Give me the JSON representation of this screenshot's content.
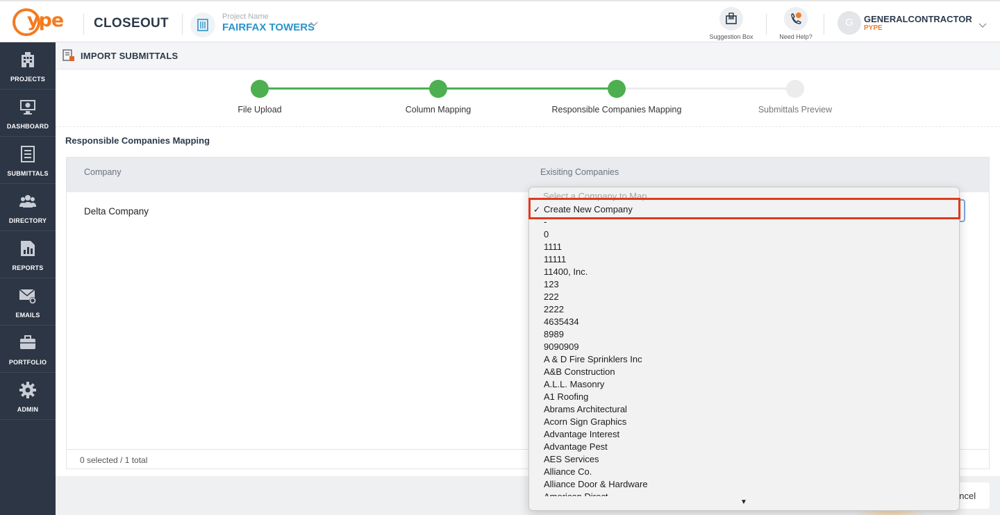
{
  "header": {
    "logo_text": "ype",
    "app_name": "CLOSEOUT",
    "project_label": "Project Name",
    "project_name": "FAIRFAX TOWERS",
    "suggestion_label": "Suggestion Box",
    "help_label": "Need Help?",
    "avatar_initial": "G",
    "user_name": "GENERALCONTRACTOR",
    "user_org": "PYPE"
  },
  "sidebar": {
    "items": [
      {
        "label": "PROJECTS",
        "icon": "building-icon"
      },
      {
        "label": "DASHBOARD",
        "icon": "monitor-icon"
      },
      {
        "label": "SUBMITTALS",
        "icon": "checklist-icon"
      },
      {
        "label": "DIRECTORY",
        "icon": "people-icon"
      },
      {
        "label": "REPORTS",
        "icon": "chart-icon"
      },
      {
        "label": "EMAILS",
        "icon": "envelope-gear-icon"
      },
      {
        "label": "PORTFOLIO",
        "icon": "briefcase-icon"
      },
      {
        "label": "ADMIN",
        "icon": "gear-icon"
      }
    ]
  },
  "page": {
    "title": "IMPORT SUBMITTALS",
    "section_title": "Responsible Companies Mapping"
  },
  "stepper": {
    "steps": [
      {
        "label": "File Upload",
        "done": true
      },
      {
        "label": "Column Mapping",
        "done": true
      },
      {
        "label": "Responsible Companies Mapping",
        "done": true
      },
      {
        "label": "Submittals Preview",
        "done": false
      }
    ]
  },
  "table": {
    "col_company": "Company",
    "col_existing": "Exisiting Companies",
    "row_company": "Delta Company",
    "footer": "0 selected / 1 total"
  },
  "footer": {
    "cancel_label": "ancel"
  },
  "dropdown": {
    "placeholder": "Select a Company to Map",
    "selected_check": "✓",
    "options": [
      "Create New Company",
      "-",
      "0",
      "1111",
      "11111",
      "11400, Inc.",
      "123",
      "222",
      "2222",
      "4635434",
      "8989",
      "9090909",
      "A & D Fire Sprinklers Inc",
      "A&B Construction",
      "A.L.L. Masonry",
      "A1 Roofing",
      "Abrams Architectural",
      "Acorn Sign Graphics",
      "Advantage Interest",
      "Advantage Pest",
      "AES Services",
      "Alliance Co.",
      "Alliance Door & Hardware",
      "American Direct"
    ],
    "scroll_arrow": "▼"
  },
  "colors": {
    "accent_orange": "#f47b20",
    "project_blue": "#2a93c9",
    "step_green": "#4caf50",
    "sidebar_bg": "#2c3645",
    "highlight_red": "#e03a1e"
  }
}
